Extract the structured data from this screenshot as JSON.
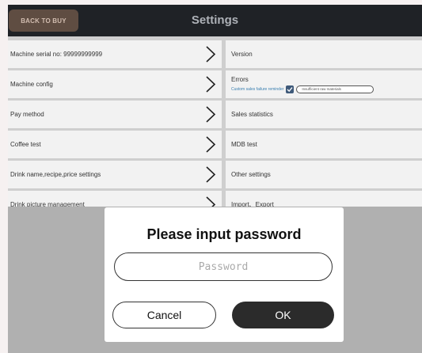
{
  "header": {
    "back_label": "BACK TO BUY",
    "title": "Settings"
  },
  "menu_left": [
    {
      "label": "Machine serial no: 99999999999"
    },
    {
      "label": "Machine config"
    },
    {
      "label": "Pay method"
    },
    {
      "label": "Coffee test"
    },
    {
      "label": "Drink name,recipe,price settings"
    },
    {
      "label": "Drink picture management"
    }
  ],
  "menu_right": {
    "version": "Version",
    "errors": "Errors",
    "errors_reminder": "Custom sales failure reminder",
    "errors_reminder_value": "Insufficient raw materials",
    "sales_statistics": "Sales statistics",
    "mdb_test": "MDB test",
    "other_settings": "Other settings",
    "import_export": "Import、Export"
  },
  "dialog": {
    "title": "Please input password",
    "password_placeholder": "Password",
    "password_value": "",
    "cancel_label": "Cancel",
    "ok_label": "OK"
  },
  "colors": {
    "topbar": "#1f2226",
    "back_button": "#5f4d42",
    "ok_button": "#2b2b2b",
    "checkbox": "#3f5a7a"
  }
}
